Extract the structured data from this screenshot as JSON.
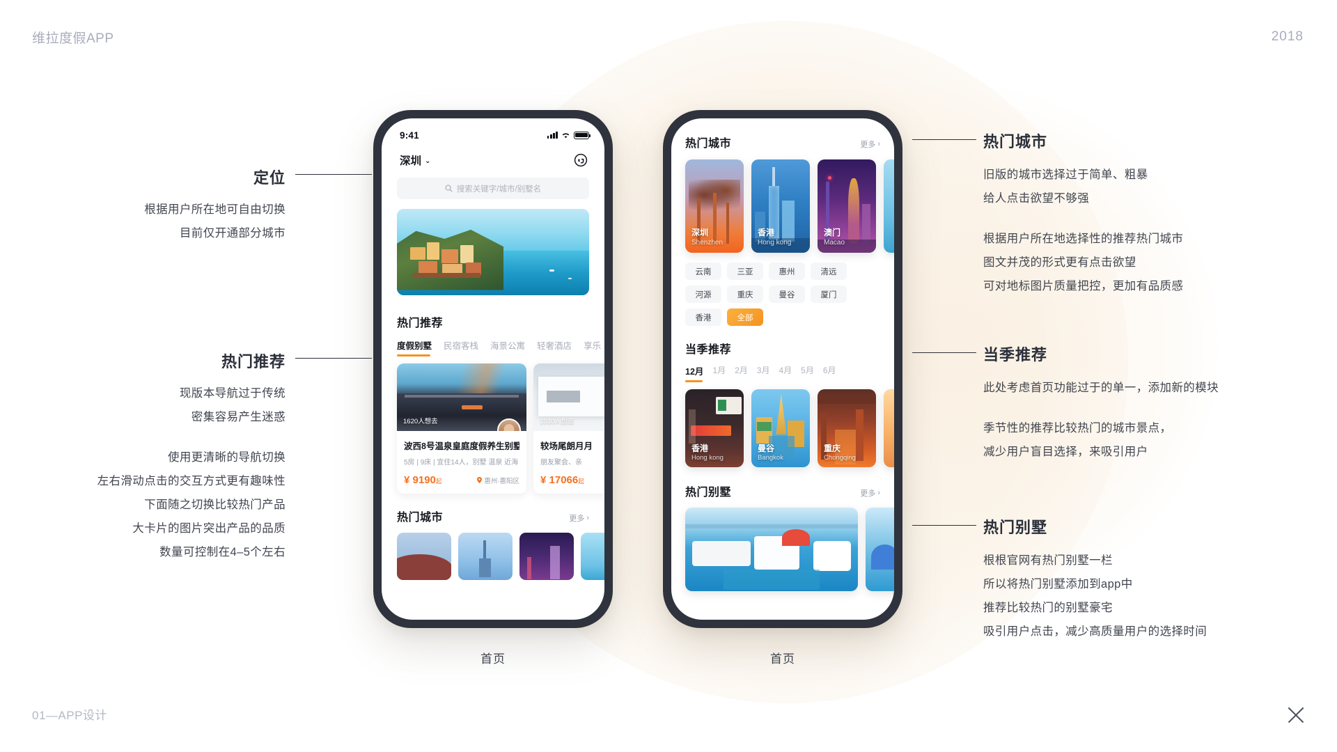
{
  "page": {
    "title": "维拉度假APP",
    "year": "2018",
    "footer": "01—APP设计",
    "close_icon": "close-icon"
  },
  "annotations": {
    "left": [
      {
        "heading": "定位",
        "paragraphs": [
          "根据用户所在地可自由切换\n目前仅开通部分城市"
        ]
      },
      {
        "heading": "热门推荐",
        "paragraphs": [
          "现版本导航过于传统\n密集容易产生迷惑",
          "使用更清晰的导航切换\n左右滑动点击的交互方式更有趣味性\n下面随之切换比较热门产品\n大卡片的图片突出产品的品质\n数量可控制在4–5个左右"
        ]
      }
    ],
    "right": [
      {
        "heading": "热门城市",
        "paragraphs": [
          "旧版的城市选择过于简单、粗暴\n给人点击欲望不够强",
          "根据用户所在地选择性的推荐热门城市\n图文并茂的形式更有点击欲望\n可对地标图片质量把控，更加有品质感"
        ]
      },
      {
        "heading": "当季推荐",
        "paragraphs": [
          "此处考虑首页功能过于的单一，添加新的模块",
          "季节性的推荐比较热门的城市景点，\n减少用户盲目选择，来吸引用户"
        ]
      },
      {
        "heading": "热门别墅",
        "paragraphs": [
          "根根官网有热门别墅一栏\n所以将热门别墅添加到app中\n推荐比较热门的别墅豪宅\n吸引用户点击，减少高质量用户的选择时间"
        ]
      }
    ]
  },
  "phone1": {
    "caption": "首页",
    "statusbar": {
      "time": "9:41",
      "signal_icon": "signal-bars-icon",
      "wifi_icon": "wifi-icon",
      "battery_icon": "battery-icon"
    },
    "location": {
      "city": "深圳",
      "caret_icon": "chevron-down-icon",
      "support_icon": "headset-icon"
    },
    "search": {
      "placeholder": "搜索关键字/城市/别墅名",
      "icon": "search-icon"
    },
    "carousel": {
      "dots": 4,
      "active_dot": 1
    },
    "hot_recommend": {
      "title": "热门推荐",
      "tabs": [
        "度假别墅",
        "民宿客栈",
        "海景公寓",
        "轻奢酒店",
        "享乐"
      ],
      "active_tab": 0,
      "cards": [
        {
          "wish": "1620人想去",
          "name": "波西8号温泉皇庭度假养生别墅",
          "sub": "5房 | 9床 | 宜住14人，别墅 温泉 近海",
          "price": "¥ 9190",
          "price_suffix": "起",
          "location": "惠州·惠阳区",
          "pin_icon": "location-pin-icon",
          "avatar_icon": "host-avatar"
        },
        {
          "wish": "1510人想去",
          "name": "较场尾朗月月",
          "sub": "朋友聚会、亲",
          "price": "¥ 17066",
          "price_suffix": "起",
          "location": "",
          "pin_icon": "location-pin-icon",
          "avatar_icon": "host-avatar"
        }
      ]
    },
    "hot_cities": {
      "title": "热门城市",
      "more": "更多",
      "more_icon": "chevron-right-icon"
    }
  },
  "phone2": {
    "caption": "首页",
    "hot_cities": {
      "title": "热门城市",
      "more": "更多",
      "more_icon": "chevron-right-icon",
      "cards": [
        {
          "cn": "深圳",
          "en": "Shenzhen"
        },
        {
          "cn": "香港",
          "en": "Hong kong"
        },
        {
          "cn": "澳门",
          "en": "Macao"
        },
        {
          "cn": "",
          "en": ""
        }
      ],
      "chips": [
        "云南",
        "三亚",
        "惠州",
        "清远",
        "河源",
        "重庆",
        "曼谷",
        "厦门",
        "香港",
        "全部"
      ],
      "active_chip": 9
    },
    "seasonal": {
      "title": "当季推荐",
      "months": [
        "12月",
        "1月",
        "2月",
        "3月",
        "4月",
        "5月",
        "6月"
      ],
      "active_month": 0,
      "cards": [
        {
          "cn": "香港",
          "en": "Hong kong"
        },
        {
          "cn": "曼谷",
          "en": "Bangkok"
        },
        {
          "cn": "重庆",
          "en": "Chongqing"
        },
        {
          "cn": "",
          "en": ""
        }
      ]
    },
    "hot_villas": {
      "title": "热门别墅",
      "more": "更多",
      "more_icon": "chevron-right-icon"
    }
  },
  "colors": {
    "accent_orange": "#f5931e",
    "price_orange": "#f5701e",
    "text_dark": "#15181f",
    "text_muted": "#9aa0ab",
    "chrome_grey": "#a8adbb"
  }
}
